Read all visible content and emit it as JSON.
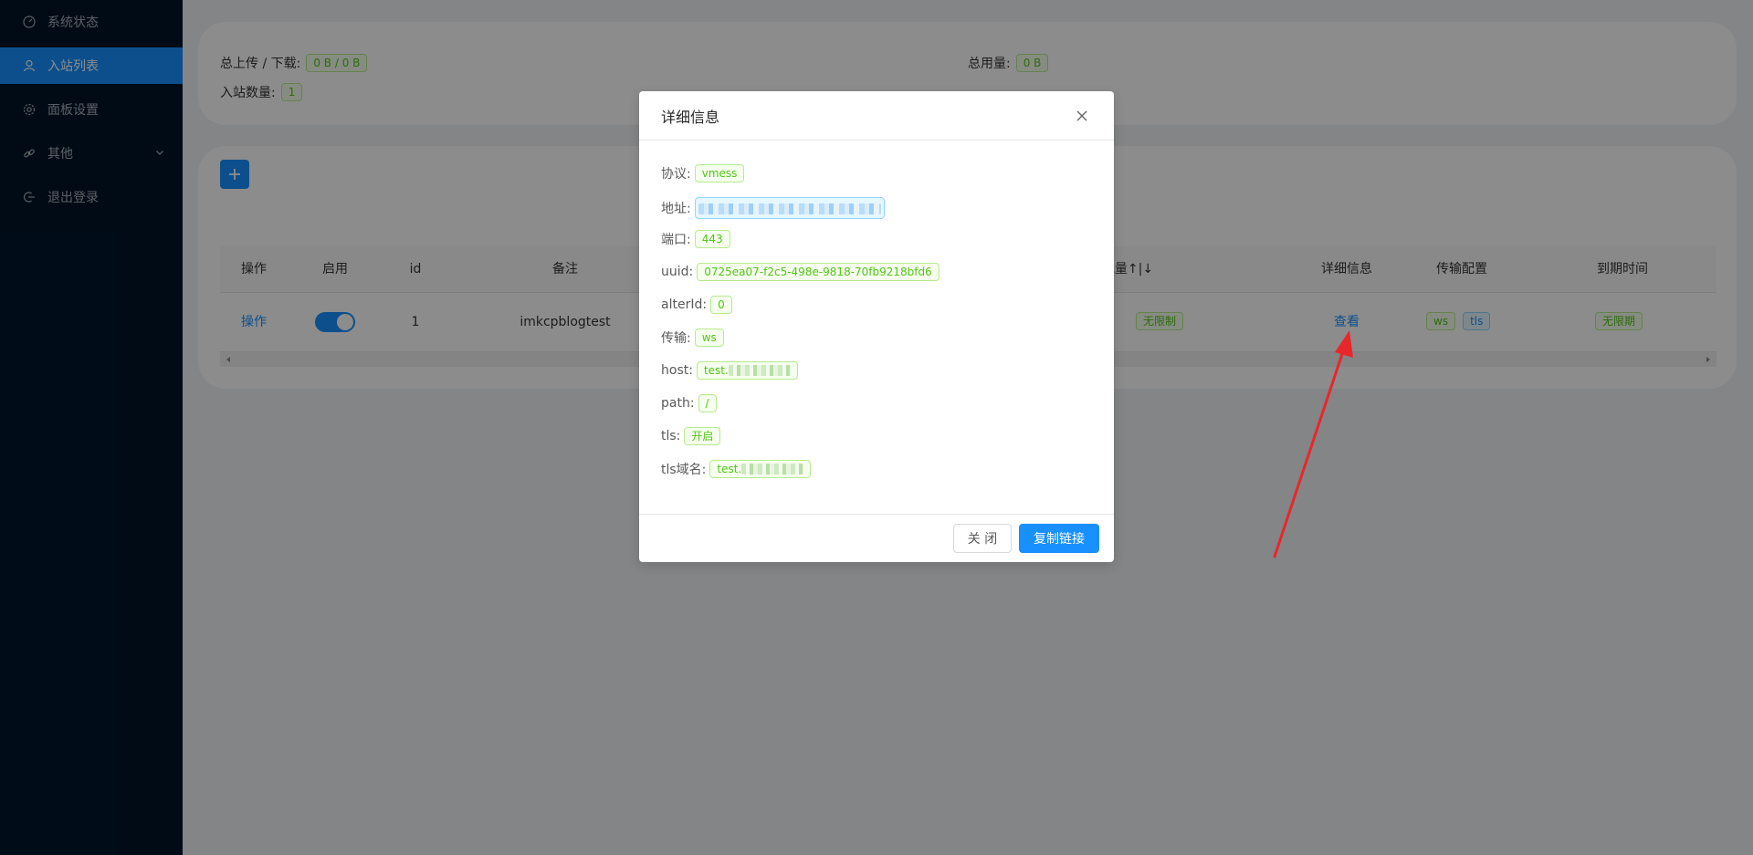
{
  "sidebar": {
    "items": [
      {
        "label": "系统状态",
        "icon": "dashboard-icon"
      },
      {
        "label": "入站列表",
        "icon": "user-icon",
        "active": true
      },
      {
        "label": "面板设置",
        "icon": "gear-icon"
      },
      {
        "label": "其他",
        "icon": "link-icon",
        "has_submenu": true
      },
      {
        "label": "退出登录",
        "icon": "logout-icon"
      }
    ]
  },
  "stats": {
    "upload_download_label": "总上传 / 下载:",
    "upload_download_value": "0 B / 0 B",
    "inbound_count_label": "入站数量:",
    "inbound_count_value": "1",
    "total_usage_label": "总用量:",
    "total_usage_value": "0 B"
  },
  "table": {
    "headers": {
      "action": "操作",
      "enable": "启用",
      "id": "id",
      "remark": "备注",
      "traffic": "流量↑|↓",
      "details": "详细信息",
      "transport": "传输配置",
      "expiry": "到期时间"
    },
    "row": {
      "action": "操作",
      "enabled": true,
      "id": "1",
      "remark": "imkcpblogtest",
      "traffic_tag": "无限制",
      "details_link": "查看",
      "transport_tags": [
        "ws",
        "tls"
      ],
      "expiry": "无限期"
    }
  },
  "modal": {
    "title": "详细信息",
    "fields": {
      "protocol": {
        "label": "协议:",
        "value": "vmess"
      },
      "address": {
        "label": "地址:"
      },
      "port": {
        "label": "端口:",
        "value": "443"
      },
      "uuid": {
        "label": "uuid:",
        "value": "0725ea07-f2c5-498e-9818-70fb9218bfd6"
      },
      "alterid": {
        "label": "alterId:",
        "value": "0"
      },
      "network": {
        "label": "传输:",
        "value": "ws"
      },
      "host": {
        "label": "host:",
        "value": "test."
      },
      "path": {
        "label": "path:",
        "value": "/"
      },
      "tls": {
        "label": "tls:",
        "value": "开启"
      },
      "tls_domain": {
        "label": "tls域名:",
        "value": "test."
      }
    },
    "close_label": "关 闭",
    "copy_label": "复制链接"
  },
  "colors": {
    "sidebar_bg": "#001529",
    "primary": "#1890ff",
    "tag_green": "#52c41a",
    "annotation_arrow": "#e8262b"
  }
}
